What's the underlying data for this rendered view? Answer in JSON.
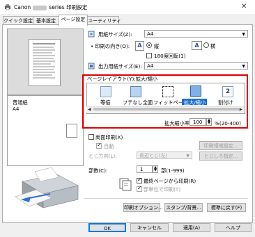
{
  "window": {
    "brand": "Canon",
    "title_suffix": "series 印刷設定",
    "close_glyph": "✕"
  },
  "tabs": [
    {
      "label": "クイック設定"
    },
    {
      "label": "基本設定"
    },
    {
      "label": "ページ設定"
    },
    {
      "label": "ユーティリティ"
    }
  ],
  "preview": {
    "media_type": "普通紙",
    "media_size": "A4"
  },
  "page_size": {
    "label": "用紙サイズ(Z):",
    "value": "A4"
  },
  "orientation": {
    "label": "印刷の向き(O):",
    "portrait": "縦",
    "landscape": "横",
    "rotate": "180度回転(1)"
  },
  "output_size": {
    "label": "出力用紙サイズ(E):",
    "value": "A4"
  },
  "layout": {
    "group_title": "ページレイアウト(Y):拡大/縮小",
    "items": [
      {
        "label": "等倍"
      },
      {
        "label": "フチなし全面"
      },
      {
        "label": "フィットページ"
      },
      {
        "label": "拡大/縮小"
      },
      {
        "label": "割付け"
      }
    ],
    "split_number": "2",
    "scale_label": "拡大縮小率:",
    "scale_value": "100",
    "scale_unit": "%(20-400)"
  },
  "duplex": {
    "label": "両面印刷(X)",
    "auto": "自動",
    "binding_label": "とじ方向(L):",
    "binding_value": "長辺とじ(左)",
    "print_area_btn": "印刷領域設定...",
    "margin_btn": "とじしろ指定..."
  },
  "copies": {
    "label": "部数(C):",
    "value": "1",
    "range": "部(1-999)",
    "last_page_first": "最終ページから印刷(R)",
    "collate": "部単位で印刷(T)"
  },
  "buttons": {
    "print_options": "印刷オプション...",
    "stamp_bg": "スタンプ/背景...",
    "defaults": "標準に戻す(F)",
    "ok": "OK",
    "cancel": "キャンセル",
    "apply": "適用(A)",
    "help": "ヘルプ"
  },
  "colors": {
    "highlight": "#1a6dd0",
    "callout": "#e00000"
  }
}
